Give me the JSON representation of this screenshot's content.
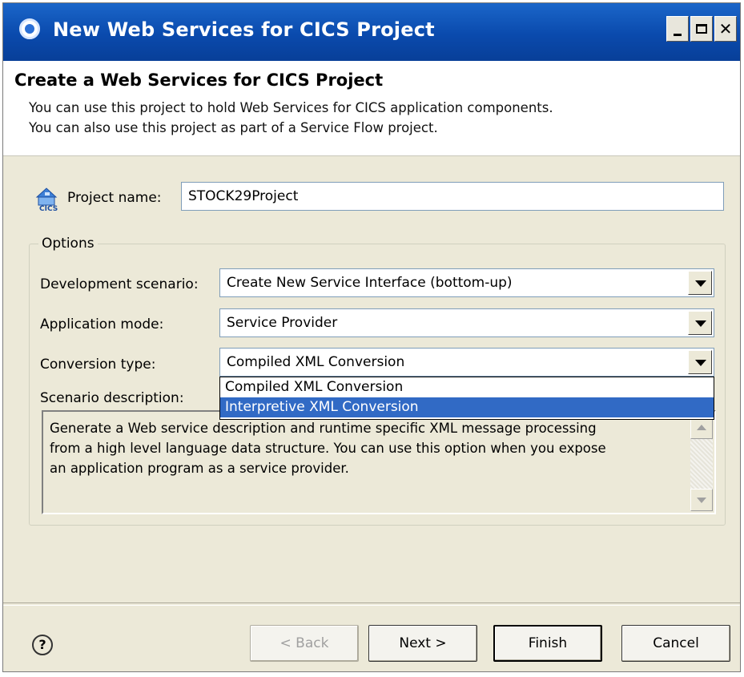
{
  "window": {
    "title": "New Web Services for CICS Project"
  },
  "header": {
    "heading": "Create a Web Services for CICS Project",
    "description_line1": "You can use this project to hold Web Services for CICS application components.",
    "description_line2": "You can also use this project as part of a Service Flow project."
  },
  "project": {
    "label": "Project name:",
    "value": "STOCK29Project",
    "icon": "cics-project-icon"
  },
  "options": {
    "legend": "Options",
    "development_scenario": {
      "label": "Development scenario:",
      "value": "Create New Service Interface (bottom-up)"
    },
    "application_mode": {
      "label": "Application mode:",
      "value": "Service Provider"
    },
    "conversion_type": {
      "label": "Conversion type:",
      "value": "Compiled XML Conversion",
      "options": [
        "Compiled XML Conversion",
        "Interpretive XML Conversion"
      ],
      "highlighted": "Interpretive XML Conversion"
    },
    "scenario_description": {
      "label": "Scenario description:",
      "line1": "Generate a Web service description and runtime specific XML message processing",
      "line2": "from a high level language data structure. You can use this option when you expose",
      "line3": "an application program as a service provider."
    }
  },
  "footer": {
    "help_glyph": "?",
    "back_label": "< Back",
    "next_label": "Next >",
    "finish_label": "Finish",
    "cancel_label": "Cancel"
  },
  "colors": {
    "title_bar": "#0a4aad",
    "selection": "#316ac5",
    "dialog_bg": "#ece9d8"
  }
}
